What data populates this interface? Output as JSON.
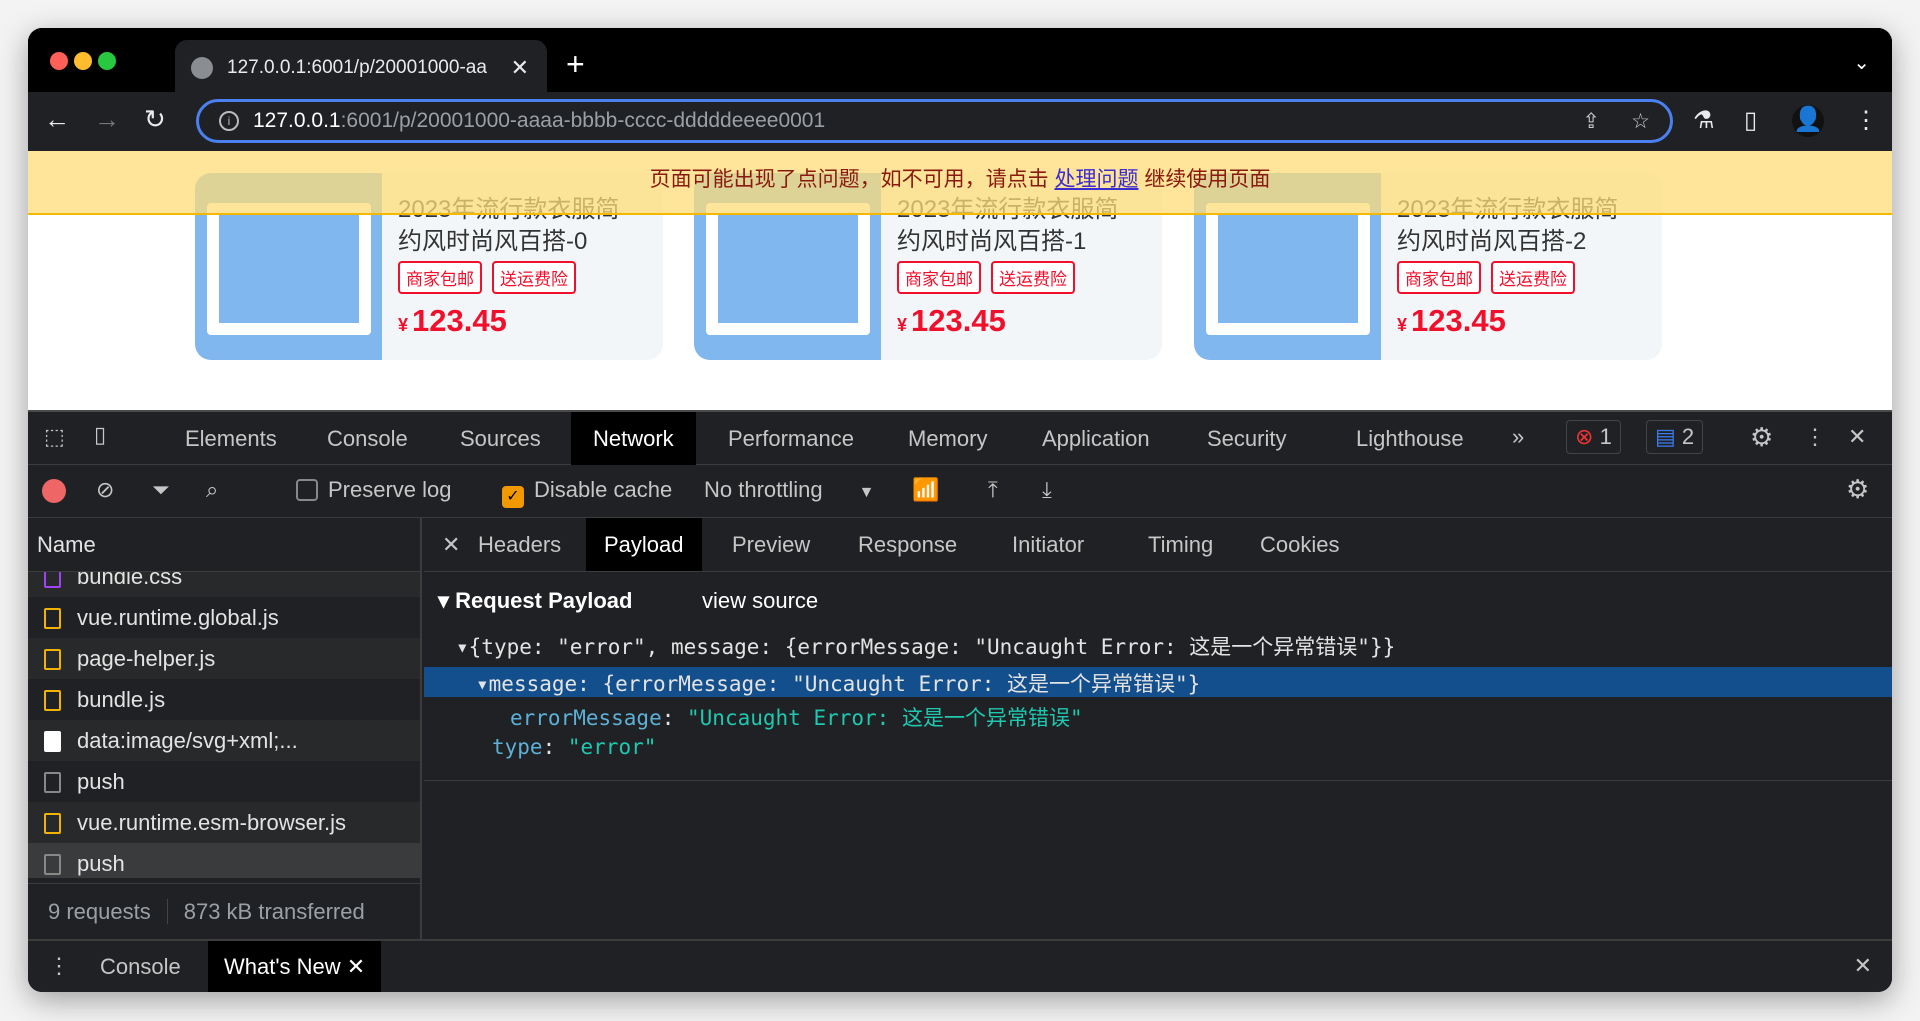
{
  "browser": {
    "tab_title": "127.0.0.1:6001/p/20001000-aa",
    "url_host": "127.0.0.1",
    "url_path": ":6001/p/20001000-aaaa-bbbb-cccc-dddddeeee0001"
  },
  "banner": {
    "text_before": "页面可能出现了点问题，如不可用，请点击 ",
    "link": "处理问题",
    "text_after": " 继续使用页面"
  },
  "products": [
    {
      "title1": "2023年流行款衣服简",
      "title2": "约风时尚风百搭-0",
      "tags": [
        "商家包邮",
        "送运费险"
      ],
      "currency": "¥",
      "price": "123.45"
    },
    {
      "title1": "2023年流行款衣服简",
      "title2": "约风时尚风百搭-1",
      "tags": [
        "商家包邮",
        "送运费险"
      ],
      "currency": "¥",
      "price": "123.45"
    },
    {
      "title1": "2023年流行款衣服简",
      "title2": "约风时尚风百搭-2",
      "tags": [
        "商家包邮",
        "送运费险"
      ],
      "currency": "¥",
      "price": "123.45"
    }
  ],
  "devtools": {
    "tabs": [
      "Elements",
      "Console",
      "Sources",
      "Network",
      "Performance",
      "Memory",
      "Application",
      "Security",
      "Lighthouse"
    ],
    "errors": "1",
    "messages": "2",
    "toolbar": {
      "preserve_log": "Preserve log",
      "disable_cache": "Disable cache",
      "throttling": "No throttling"
    },
    "name_header": "Name",
    "requests": [
      "bundle.css",
      "vue.runtime.global.js",
      "page-helper.js",
      "bundle.js",
      "data:image/svg+xml;...",
      "push",
      "vue.runtime.esm-browser.js",
      "push"
    ],
    "footer": {
      "requests": "9 requests",
      "transferred": "873 kB transferred"
    },
    "subtabs": [
      "Headers",
      "Payload",
      "Preview",
      "Response",
      "Initiator",
      "Timing",
      "Cookies"
    ],
    "payload": {
      "title": "Request Payload",
      "view_source": "view source",
      "line1": "{type: \"error\", message: {errorMessage: \"Uncaught Error: 这是一个异常错误\"}}",
      "line2": "message: {errorMessage: \"Uncaught Error: 这是一个异常错误\"}",
      "key3": "errorMessage",
      "val3": "\"Uncaught Error: 这是一个异常错误\"",
      "key4": "type",
      "val4": "\"error\""
    },
    "drawer": {
      "console": "Console",
      "whats_new": "What's New"
    }
  }
}
